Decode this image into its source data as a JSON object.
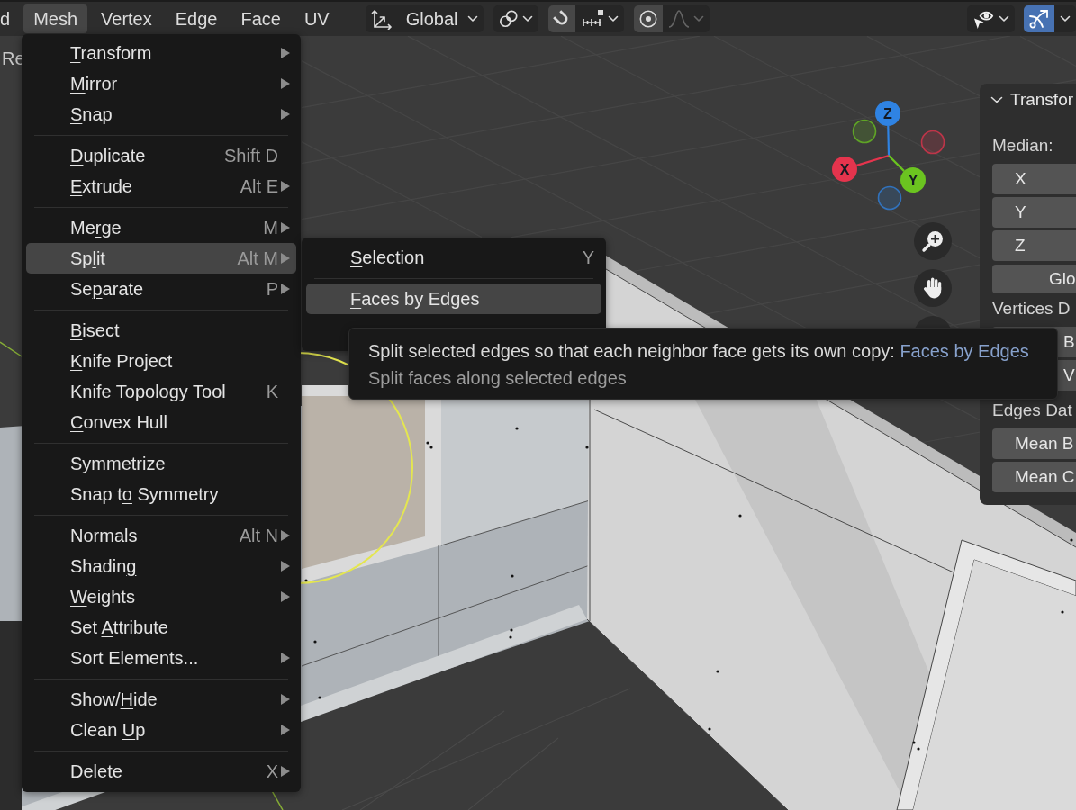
{
  "header": {
    "menus": [
      {
        "label": "d",
        "selected": false
      },
      {
        "label": "Mesh",
        "selected": true
      },
      {
        "label": "Vertex",
        "selected": false
      },
      {
        "label": "Edge",
        "selected": false
      },
      {
        "label": "Face",
        "selected": false
      },
      {
        "label": "UV",
        "selected": false
      }
    ],
    "tool_groups": [
      {
        "items": [
          {
            "kind": "dropdown",
            "label": "Global",
            "disabled": false
          }
        ]
      },
      {
        "items": [
          {
            "kind": "dropdown",
            "disabled": false
          }
        ]
      },
      {
        "items": [
          {
            "kind": "toggle",
            "on": false
          },
          {
            "kind": "dropdown",
            "disabled": false
          }
        ]
      },
      {
        "items": [
          {
            "kind": "toggle",
            "on": false
          },
          {
            "kind": "dropdown",
            "disabled": true
          }
        ]
      }
    ],
    "right_groups": [
      {
        "items": [
          {
            "kind": "dropdown",
            "disabled": false
          }
        ]
      },
      {
        "items": [
          {
            "kind": "toggle",
            "on": true
          },
          {
            "kind": "dropdown",
            "disabled": false
          }
        ]
      }
    ]
  },
  "viewport": {
    "corner_text": "Re"
  },
  "menu": {
    "items": [
      {
        "kind": "item",
        "label": [
          {
            "text": "T",
            "underlined": true
          },
          {
            "text": "ransform",
            "underlined": false
          }
        ],
        "submenu": true,
        "selected": false
      },
      {
        "kind": "item",
        "label": [
          {
            "text": "M",
            "underlined": true
          },
          {
            "text": "irror",
            "underlined": false
          }
        ],
        "submenu": true,
        "selected": false
      },
      {
        "kind": "item",
        "label": [
          {
            "text": "S",
            "underlined": true
          },
          {
            "text": "nap",
            "underlined": false
          }
        ],
        "submenu": true,
        "selected": false
      },
      {
        "kind": "separator"
      },
      {
        "kind": "item",
        "label": [
          {
            "text": "D",
            "underlined": true
          },
          {
            "text": "uplicate",
            "underlined": false
          }
        ],
        "shortcut": "Shift D",
        "submenu": false,
        "selected": false
      },
      {
        "kind": "item",
        "label": [
          {
            "text": "E",
            "underlined": true
          },
          {
            "text": "xtrude",
            "underlined": false
          }
        ],
        "shortcut": "Alt E",
        "submenu": true,
        "selected": false
      },
      {
        "kind": "separator"
      },
      {
        "kind": "item",
        "label": [
          {
            "text": "Me",
            "underlined": false
          },
          {
            "text": "r",
            "underlined": true
          },
          {
            "text": "ge",
            "underlined": false
          }
        ],
        "shortcut": "M",
        "submenu": true,
        "selected": false
      },
      {
        "kind": "item",
        "label": [
          {
            "text": "Sp",
            "underlined": false
          },
          {
            "text": "l",
            "underlined": true
          },
          {
            "text": "it",
            "underlined": false
          }
        ],
        "shortcut": "Alt M",
        "submenu": true,
        "selected": true
      },
      {
        "kind": "item",
        "label": [
          {
            "text": "Se",
            "underlined": false
          },
          {
            "text": "p",
            "underlined": true
          },
          {
            "text": "arate",
            "underlined": false
          }
        ],
        "shortcut": "P",
        "submenu": true,
        "selected": false
      },
      {
        "kind": "separator"
      },
      {
        "kind": "item",
        "label": [
          {
            "text": "B",
            "underlined": true
          },
          {
            "text": "isect",
            "underlined": false
          }
        ],
        "submenu": false,
        "selected": false
      },
      {
        "kind": "item",
        "label": [
          {
            "text": "K",
            "underlined": true
          },
          {
            "text": "nife Project",
            "underlined": false
          }
        ],
        "submenu": false,
        "selected": false
      },
      {
        "kind": "item",
        "label": [
          {
            "text": "Kn",
            "underlined": false
          },
          {
            "text": "i",
            "underlined": true
          },
          {
            "text": "fe Topology Tool",
            "underlined": false
          }
        ],
        "shortcut": "K",
        "submenu": false,
        "selected": false
      },
      {
        "kind": "item",
        "label": [
          {
            "text": "C",
            "underlined": true
          },
          {
            "text": "onvex Hull",
            "underlined": false
          }
        ],
        "submenu": false,
        "selected": false
      },
      {
        "kind": "separator"
      },
      {
        "kind": "item",
        "label": [
          {
            "text": "S",
            "underlined": false
          },
          {
            "text": "y",
            "underlined": true
          },
          {
            "text": "mmetrize",
            "underlined": false
          }
        ],
        "submenu": false,
        "selected": false
      },
      {
        "kind": "item",
        "label": [
          {
            "text": "Snap t",
            "underlined": false
          },
          {
            "text": "o",
            "underlined": true
          },
          {
            "text": " Symmetry",
            "underlined": false
          }
        ],
        "submenu": false,
        "selected": false
      },
      {
        "kind": "separator"
      },
      {
        "kind": "item",
        "label": [
          {
            "text": "N",
            "underlined": true
          },
          {
            "text": "ormals",
            "underlined": false
          }
        ],
        "shortcut": "Alt N",
        "submenu": true,
        "selected": false
      },
      {
        "kind": "item",
        "label": [
          {
            "text": "Shadin",
            "underlined": false
          },
          {
            "text": "g",
            "underlined": true
          }
        ],
        "submenu": true,
        "selected": false
      },
      {
        "kind": "item",
        "label": [
          {
            "text": "W",
            "underlined": true
          },
          {
            "text": "eights",
            "underlined": false
          }
        ],
        "submenu": true,
        "selected": false
      },
      {
        "kind": "item",
        "label": [
          {
            "text": "Set ",
            "underlined": false
          },
          {
            "text": "A",
            "underlined": true
          },
          {
            "text": "ttribute",
            "underlined": false
          }
        ],
        "submenu": false,
        "selected": false
      },
      {
        "kind": "item",
        "label": [
          {
            "text": "Sort Elements...",
            "underlined": false
          }
        ],
        "submenu": true,
        "selected": false
      },
      {
        "kind": "separator"
      },
      {
        "kind": "item",
        "label": [
          {
            "text": "Show/",
            "underlined": false
          },
          {
            "text": "H",
            "underlined": true
          },
          {
            "text": "ide",
            "underlined": false
          }
        ],
        "submenu": true,
        "selected": false
      },
      {
        "kind": "item",
        "label": [
          {
            "text": "Clean ",
            "underlined": false
          },
          {
            "text": "U",
            "underlined": true
          },
          {
            "text": "p",
            "underlined": false
          }
        ],
        "submenu": true,
        "selected": false
      },
      {
        "kind": "separator"
      },
      {
        "kind": "item",
        "label": [
          {
            "text": "Delete",
            "underlined": false
          }
        ],
        "shortcut": "X",
        "submenu": true,
        "selected": false
      }
    ]
  },
  "submenu": {
    "items": [
      {
        "kind": "item",
        "label": [
          {
            "text": "S",
            "underlined": true
          },
          {
            "text": "election",
            "underlined": false
          }
        ],
        "shortcut": "Y",
        "submenu": false,
        "selected": false
      },
      {
        "kind": "separator"
      },
      {
        "kind": "item",
        "label": [
          {
            "text": "F",
            "underlined": true
          },
          {
            "text": "aces by Edges",
            "underlined": false
          }
        ],
        "submenu": false,
        "selected": true
      }
    ]
  },
  "tooltip": {
    "description": "Split selected edges so that each neighbor face gets its own copy:",
    "operator": "Faces by Edges",
    "detail": "Split faces along selected edges"
  },
  "gizmo": {
    "axes": [
      {
        "label": "Z",
        "color": "#2f83e3"
      },
      {
        "label": "X",
        "color": "#e5344d"
      },
      {
        "label": "Y",
        "color": "#6bc420"
      }
    ]
  },
  "sidebar": {
    "header": {
      "label": "Transfor",
      "expanded": true
    },
    "rows": [
      {
        "kind": "label",
        "text": "Median:"
      },
      {
        "kind": "field",
        "text": "X"
      },
      {
        "kind": "field",
        "text": "Y"
      },
      {
        "kind": "field",
        "text": "Z"
      },
      {
        "kind": "button",
        "text": "Glo"
      },
      {
        "kind": "label",
        "text": "Vertices D"
      },
      {
        "kind": "slider",
        "text": "B"
      },
      {
        "kind": "slider",
        "text": "V"
      },
      {
        "kind": "label",
        "text": "Edges Dat"
      },
      {
        "kind": "field",
        "text": "Mean B"
      },
      {
        "kind": "field",
        "text": "Mean C"
      }
    ]
  }
}
